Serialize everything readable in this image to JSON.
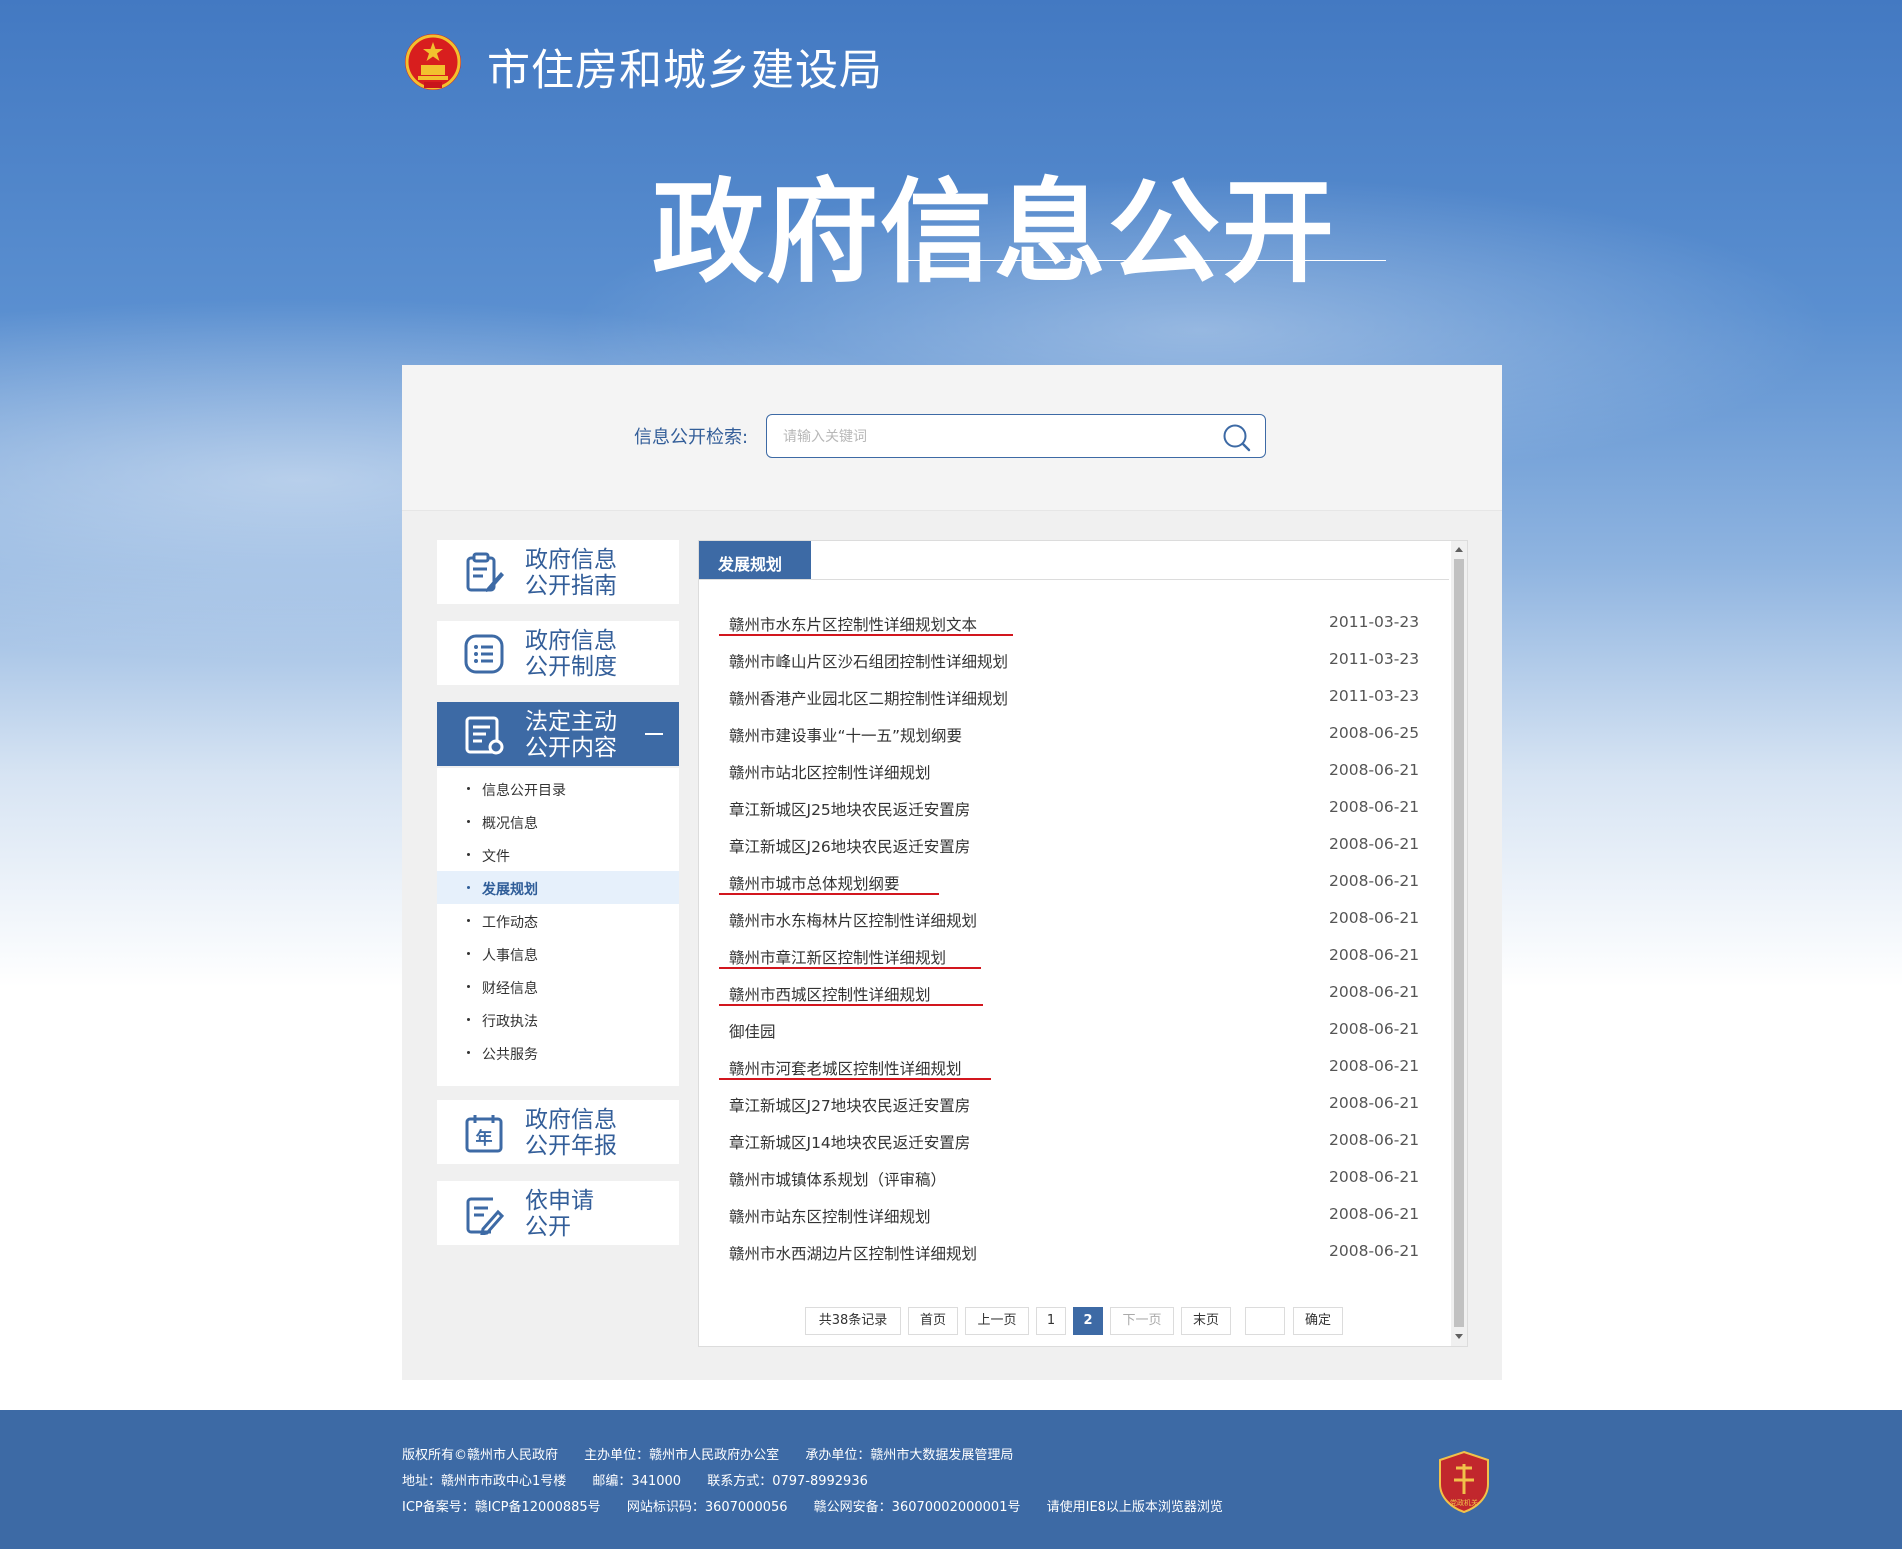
{
  "header": {
    "site_title": "市住房和城乡建设局",
    "big_title": "政府信息公开"
  },
  "search": {
    "label": "信息公开检索:",
    "placeholder": "请输入关键词"
  },
  "nav": {
    "guide": [
      "政府信息",
      "公开指南"
    ],
    "system": [
      "政府信息",
      "公开制度"
    ],
    "content": [
      "法定主动",
      "公开内容"
    ],
    "annual": [
      "政府信息",
      "公开年报"
    ],
    "apply": [
      "依申请",
      "公开"
    ]
  },
  "submenu": [
    "信息公开目录",
    "概况信息",
    "文件",
    "发展规划",
    "工作动态",
    "人事信息",
    "财经信息",
    "行政执法",
    "公共服务"
  ],
  "submenu_active": "发展规划",
  "list": {
    "tab_title": "发展规划",
    "items": [
      {
        "title": "赣州市水东片区控制性详细规划文本",
        "date": "2011-03-23"
      },
      {
        "title": "赣州市峰山片区沙石组团控制性详细规划",
        "date": "2011-03-23"
      },
      {
        "title": "赣州香港产业园北区二期控制性详细规划",
        "date": "2011-03-23"
      },
      {
        "title": "赣州市建设事业“十一五”规划纲要",
        "date": "2008-06-25"
      },
      {
        "title": "赣州市站北区控制性详细规划",
        "date": "2008-06-21"
      },
      {
        "title": "章江新城区J25地块农民返迁安置房",
        "date": "2008-06-21"
      },
      {
        "title": "章江新城区J26地块农民返迁安置房",
        "date": "2008-06-21"
      },
      {
        "title": "赣州市城市总体规划纲要",
        "date": "2008-06-21"
      },
      {
        "title": "赣州市水东梅林片区控制性详细规划",
        "date": "2008-06-21"
      },
      {
        "title": "赣州市章江新区控制性详细规划",
        "date": "2008-06-21"
      },
      {
        "title": "赣州市西城区控制性详细规划",
        "date": "2008-06-21"
      },
      {
        "title": "御佳园",
        "date": "2008-06-21"
      },
      {
        "title": "赣州市河套老城区控制性详细规划",
        "date": "2008-06-21"
      },
      {
        "title": "章江新城区J27地块农民返迁安置房",
        "date": "2008-06-21"
      },
      {
        "title": "章江新城区J14地块农民返迁安置房",
        "date": "2008-06-21"
      },
      {
        "title": "赣州市城镇体系规划（评审稿）",
        "date": "2008-06-21"
      },
      {
        "title": "赣州市站东区控制性详细规划",
        "date": "2008-06-21"
      },
      {
        "title": "赣州市水西湖边片区控制性详细规划",
        "date": "2008-06-21"
      }
    ]
  },
  "pager": {
    "total": "共38条记录",
    "first": "首页",
    "prev": "上一页",
    "page1": "1",
    "page2": "2",
    "next": "下一页",
    "last": "末页",
    "confirm": "确定"
  },
  "footer": {
    "line1": [
      "版权所有©赣州市人民政府",
      "主办单位：赣州市人民政府办公室",
      "承办单位：赣州市大数据发展管理局"
    ],
    "line2": [
      "地址：赣州市市政中心1号楼",
      "邮编：341000",
      "联系方式：0797-8992936"
    ],
    "line3": [
      "ICP备案号：赣ICP备12000885号",
      "网站标识码：3607000056",
      "赣公网安备：36070002000001号",
      "请使用IE8以上版本浏览器浏览"
    ],
    "badge_text": "党政机关"
  },
  "colors": {
    "primary": "#3d6aa5",
    "accent_red": "#d2161e"
  }
}
